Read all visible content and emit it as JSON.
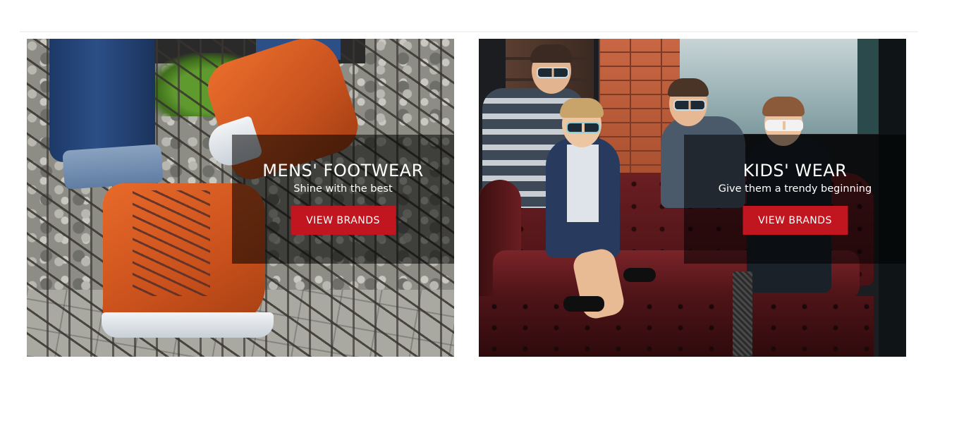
{
  "banners": [
    {
      "title": "MENS' FOOTWEAR",
      "subtitle": "Shine with the best",
      "button_label": "VIEW BRANDS",
      "image_subject": "orange high-top sneakers on cobblestones"
    },
    {
      "title": "KIDS' WEAR",
      "subtitle": "Give them a trendy beginning",
      "button_label": "VIEW BRANDS",
      "image_subject": "four kids in sunglasses on a leather sofa"
    }
  ],
  "colors": {
    "button": "#c1161f",
    "overlay": "rgba(0,0,0,0.55)",
    "text": "#ffffff"
  }
}
